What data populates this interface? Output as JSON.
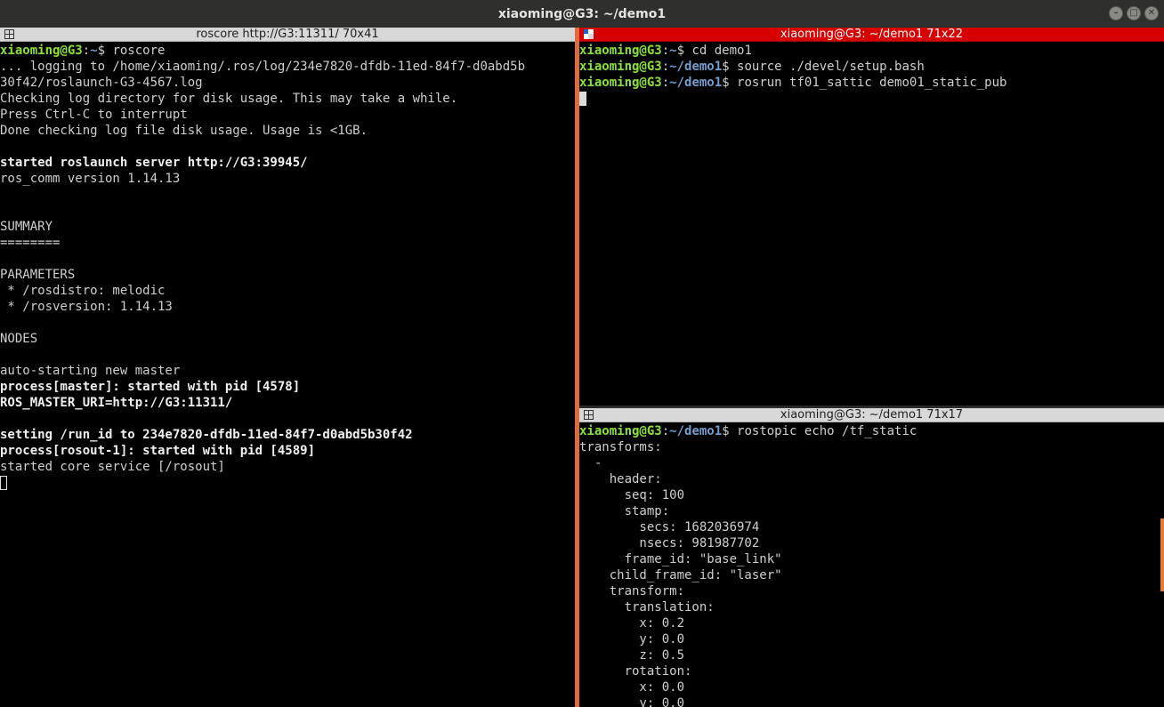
{
  "window": {
    "title": "xiaoming@G3: ~/demo1",
    "controls": {
      "minimize": "minimize-icon",
      "maximize": "maximize-icon",
      "close": "close-icon"
    }
  },
  "colors": {
    "prompt_user": "#8ae234",
    "prompt_path": "#729fcf",
    "active_bar": "#d70000",
    "divider": "#de6b3c"
  },
  "panes": {
    "left": {
      "title": "roscore http://G3:11311/ 70x41",
      "lines": [
        {
          "user": "xiaoming@G3",
          "sep": ":",
          "path": "~",
          "dollar": "$ ",
          "cmd": "roscore"
        },
        {
          "dim": "... logging to /home/xiaoming/.ros/log/234e7820-dfdb-11ed-84f7-d0abd5b"
        },
        {
          "dim": "30f42/roslaunch-G3-4567.log"
        },
        {
          "dim": "Checking log directory for disk usage. This may take a while."
        },
        {
          "dim": "Press Ctrl-C to interrupt"
        },
        {
          "dim": "Done checking log file disk usage. Usage is <1GB."
        },
        {
          "dim": ""
        },
        {
          "bold": "started roslaunch server http://G3:39945/"
        },
        {
          "dim": "ros_comm version 1.14.13"
        },
        {
          "dim": ""
        },
        {
          "dim": ""
        },
        {
          "dim": "SUMMARY"
        },
        {
          "dim": "========"
        },
        {
          "dim": ""
        },
        {
          "dim": "PARAMETERS"
        },
        {
          "dim": " * /rosdistro: melodic"
        },
        {
          "dim": " * /rosversion: 1.14.13"
        },
        {
          "dim": ""
        },
        {
          "dim": "NODES"
        },
        {
          "dim": ""
        },
        {
          "dim": "auto-starting new master"
        },
        {
          "bold": "process[master]: started with pid [4578]"
        },
        {
          "bold": "ROS_MASTER_URI=http://G3:11311/"
        },
        {
          "dim": ""
        },
        {
          "bold": "setting /run_id to 234e7820-dfdb-11ed-84f7-d0abd5b30f42"
        },
        {
          "bold": "process[rosout-1]: started with pid [4589]"
        },
        {
          "dim": "started core service [/rosout]"
        }
      ]
    },
    "top_right": {
      "title": "xiaoming@G3: ~/demo1 71x22",
      "lines": [
        {
          "user": "xiaoming@G3",
          "sep": ":",
          "path": "~",
          "dollar": "$ ",
          "cmd": "cd demo1"
        },
        {
          "user": "xiaoming@G3",
          "sep": ":",
          "path": "~/demo1",
          "dollar": "$ ",
          "cmd": "source ./devel/setup.bash"
        },
        {
          "user": "xiaoming@G3",
          "sep": ":",
          "path": "~/demo1",
          "dollar": "$ ",
          "cmd": "rosrun tf01_sattic demo01_static_pub"
        }
      ]
    },
    "bottom_right": {
      "title": "xiaoming@G3: ~/demo1 71x17",
      "lines": [
        {
          "user": "xiaoming@G3",
          "sep": ":",
          "path": "~/demo1",
          "dollar": "$ ",
          "cmd": "rostopic echo /tf_static"
        },
        {
          "dim": "transforms:"
        },
        {
          "dim": "  -"
        },
        {
          "dim": "    header:"
        },
        {
          "dim": "      seq: 100"
        },
        {
          "dim": "      stamp:"
        },
        {
          "dim": "        secs: 1682036974"
        },
        {
          "dim": "        nsecs: 981987702"
        },
        {
          "dim": "      frame_id: \"base_link\""
        },
        {
          "dim": "    child_frame_id: \"laser\""
        },
        {
          "dim": "    transform:"
        },
        {
          "dim": "      translation:"
        },
        {
          "dim": "        x: 0.2"
        },
        {
          "dim": "        y: 0.0"
        },
        {
          "dim": "        z: 0.5"
        },
        {
          "dim": "      rotation:"
        },
        {
          "dim": "        x: 0.0"
        },
        {
          "dim": "        y: 0.0"
        }
      ]
    }
  }
}
